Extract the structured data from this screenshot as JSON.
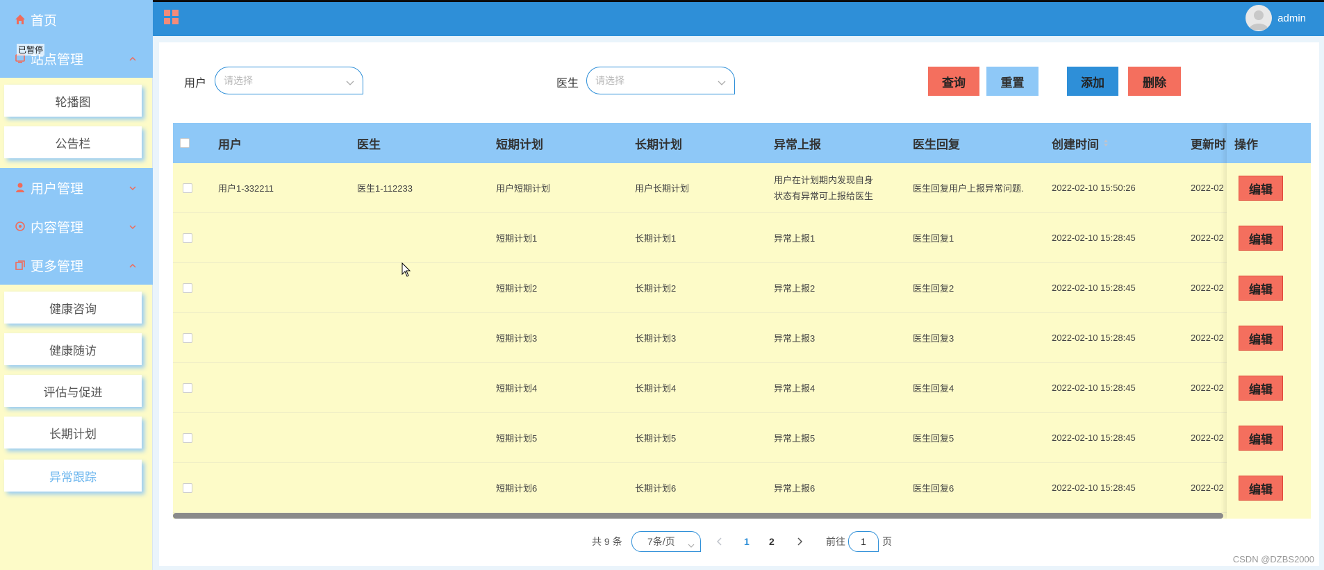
{
  "sidebar": {
    "tooltip": "已暂停",
    "menus": [
      {
        "label": "首页",
        "icon": "home-icon"
      },
      {
        "label": "站点管理",
        "icon": "site-icon"
      },
      {
        "label": "用户管理",
        "icon": "user-icon"
      },
      {
        "label": "内容管理",
        "icon": "content-icon"
      },
      {
        "label": "更多管理",
        "icon": "more-icon"
      }
    ],
    "site_items": [
      "轮播图",
      "公告栏"
    ],
    "more_items": [
      "健康咨询",
      "健康随访",
      "评估与促进",
      "长期计划",
      "异常跟踪"
    ],
    "active_item": "异常跟踪"
  },
  "topbar": {
    "username": "admin"
  },
  "filters": {
    "user_label": "用户",
    "user_placeholder": "请选择",
    "doctor_label": "医生",
    "doctor_placeholder": "请选择"
  },
  "buttons": {
    "query": "查询",
    "reset": "重置",
    "add": "添加",
    "delete": "删除"
  },
  "table": {
    "columns": [
      "用户",
      "医生",
      "短期计划",
      "长期计划",
      "异常上报",
      "医生回复",
      "创建时间",
      "更新时间",
      "操作"
    ],
    "edit_label": "编辑",
    "rows": [
      {
        "user": "用户1-332211",
        "doctor": "医生1-112233",
        "short": "用户短期计划",
        "long": "用户长期计划",
        "report": "用户在计划期内发现自身状态有异常可上报给医生",
        "reply": "医生回复用户上报异常问题.",
        "created": "2022-02-10 15:50:26",
        "updated": "2022-02"
      },
      {
        "user": "",
        "doctor": "",
        "short": "短期计划1",
        "long": "长期计划1",
        "report": "异常上报1",
        "reply": "医生回复1",
        "created": "2022-02-10 15:28:45",
        "updated": "2022-02"
      },
      {
        "user": "",
        "doctor": "",
        "short": "短期计划2",
        "long": "长期计划2",
        "report": "异常上报2",
        "reply": "医生回复2",
        "created": "2022-02-10 15:28:45",
        "updated": "2022-02"
      },
      {
        "user": "",
        "doctor": "",
        "short": "短期计划3",
        "long": "长期计划3",
        "report": "异常上报3",
        "reply": "医生回复3",
        "created": "2022-02-10 15:28:45",
        "updated": "2022-02"
      },
      {
        "user": "",
        "doctor": "",
        "short": "短期计划4",
        "long": "长期计划4",
        "report": "异常上报4",
        "reply": "医生回复4",
        "created": "2022-02-10 15:28:45",
        "updated": "2022-02"
      },
      {
        "user": "",
        "doctor": "",
        "short": "短期计划5",
        "long": "长期计划5",
        "report": "异常上报5",
        "reply": "医生回复5",
        "created": "2022-02-10 15:28:45",
        "updated": "2022-02"
      },
      {
        "user": "",
        "doctor": "",
        "short": "短期计划6",
        "long": "长期计划6",
        "report": "异常上报6",
        "reply": "医生回复6",
        "created": "2022-02-10 15:28:45",
        "updated": "2022-02"
      }
    ]
  },
  "pagination": {
    "total": "共 9 条",
    "page_size": "7条/页",
    "pages": [
      "1",
      "2"
    ],
    "current_page": "1",
    "goto_prefix": "前往",
    "goto_value": "1",
    "goto_suffix": "页"
  },
  "watermark": "CSDN @DZBS2000",
  "colors": {
    "sidebar_menu": "#8ec8f7",
    "sidebar_bg": "#fdfbc8",
    "topbar": "#2e8fd8",
    "accent_red": "#f46f5e",
    "accent_blue": "#2e8fd8",
    "reset_blue": "#8ec8f7"
  }
}
